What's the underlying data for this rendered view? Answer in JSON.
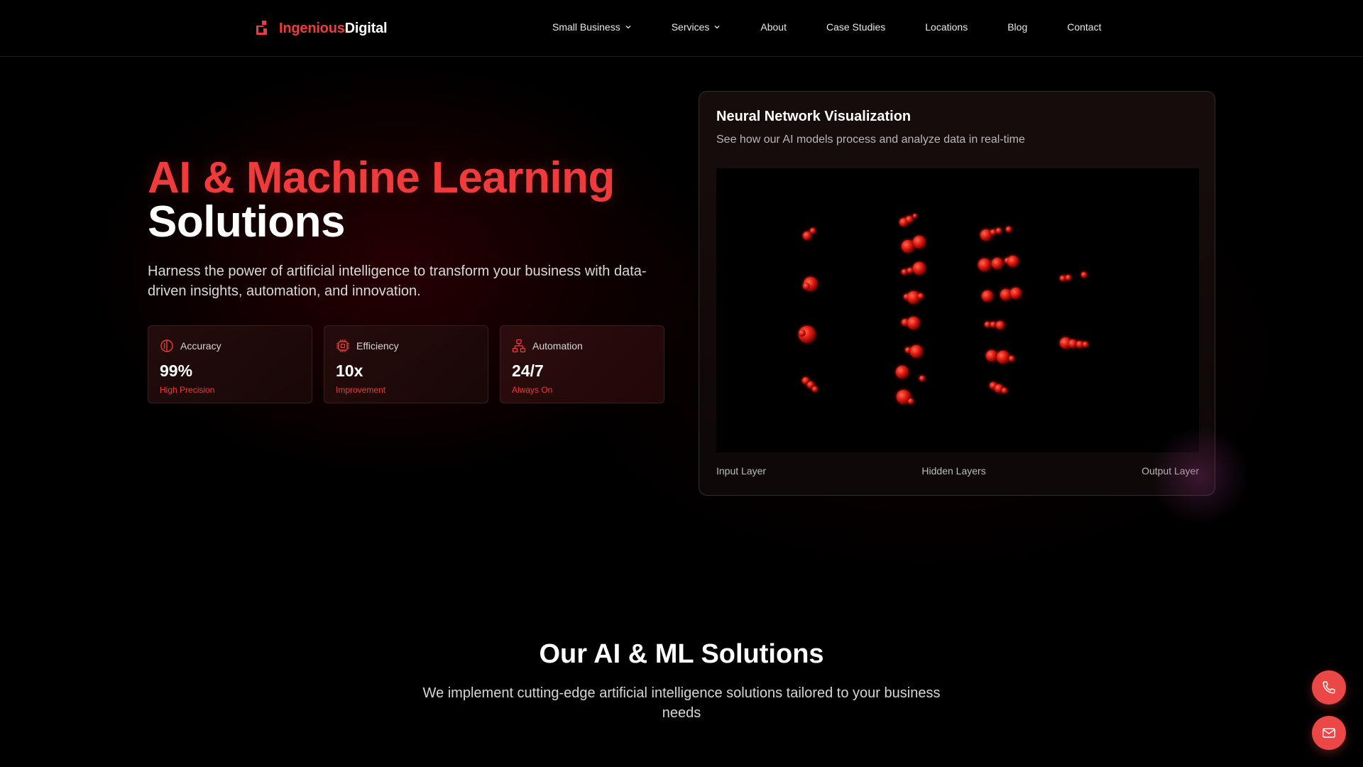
{
  "brand": {
    "name_part1": "Ingenious",
    "name_part2": "Digital"
  },
  "nav": {
    "items": [
      {
        "label": "Small Business",
        "dropdown": true
      },
      {
        "label": "Services",
        "dropdown": true
      },
      {
        "label": "About",
        "dropdown": false
      },
      {
        "label": "Case Studies",
        "dropdown": false
      },
      {
        "label": "Locations",
        "dropdown": false
      },
      {
        "label": "Blog",
        "dropdown": false
      },
      {
        "label": "Contact",
        "dropdown": false
      }
    ]
  },
  "hero": {
    "title_line1": "AI & Machine Learning",
    "title_line2": "Solutions",
    "description": "Harness the power of artificial intelligence to transform your business with data-driven insights, automation, and innovation.",
    "stats": [
      {
        "icon": "brain-icon",
        "label": "Accuracy",
        "value": "99%",
        "sub": "High Precision"
      },
      {
        "icon": "chip-icon",
        "label": "Efficiency",
        "value": "10x",
        "sub": "Improvement"
      },
      {
        "icon": "network-icon",
        "label": "Automation",
        "value": "24/7",
        "sub": "Always On"
      }
    ]
  },
  "neural_card": {
    "title": "Neural Network Visualization",
    "subtitle": "See how our AI models process and analyze data in real-time",
    "labels": {
      "input": "Input Layer",
      "hidden": "Hidden Layers",
      "output": "Output Layer"
    }
  },
  "solutions": {
    "title": "Our AI & ML Solutions",
    "description": "We implement cutting-edge artificial intelligence solutions tailored to your business needs"
  },
  "colors": {
    "accent": "#ef3b3b",
    "fab": "#ec4747",
    "background": "#000000"
  },
  "fabs": [
    {
      "icon": "phone-icon"
    },
    {
      "icon": "mail-icon"
    }
  ]
}
